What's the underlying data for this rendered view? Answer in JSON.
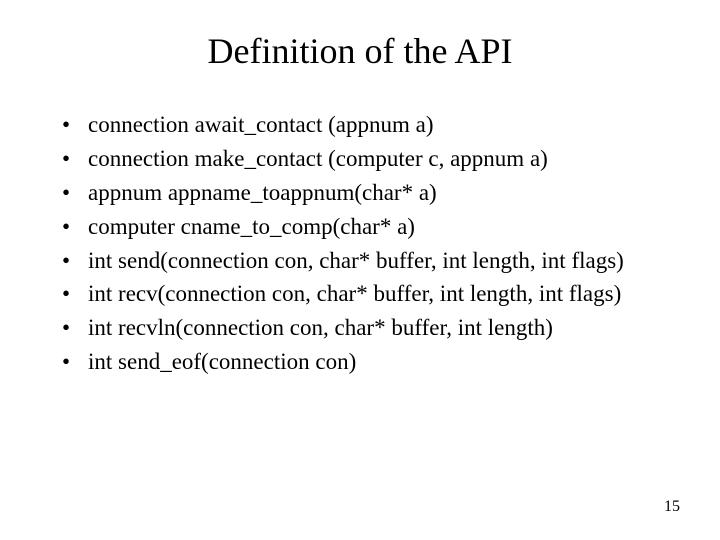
{
  "title": "Definition of the API",
  "bullets": [
    "connection await_contact (appnum a)",
    "connection make_contact (computer c, appnum a)",
    "appnum appname_toappnum(char* a)",
    "computer cname_to_comp(char* a)",
    "int send(connection con, char* buffer, int length, int flags)",
    "int recv(connection con, char* buffer, int length, int flags)",
    "int recvln(connection con, char* buffer, int length)",
    "int send_eof(connection con)"
  ],
  "page_number": "15"
}
